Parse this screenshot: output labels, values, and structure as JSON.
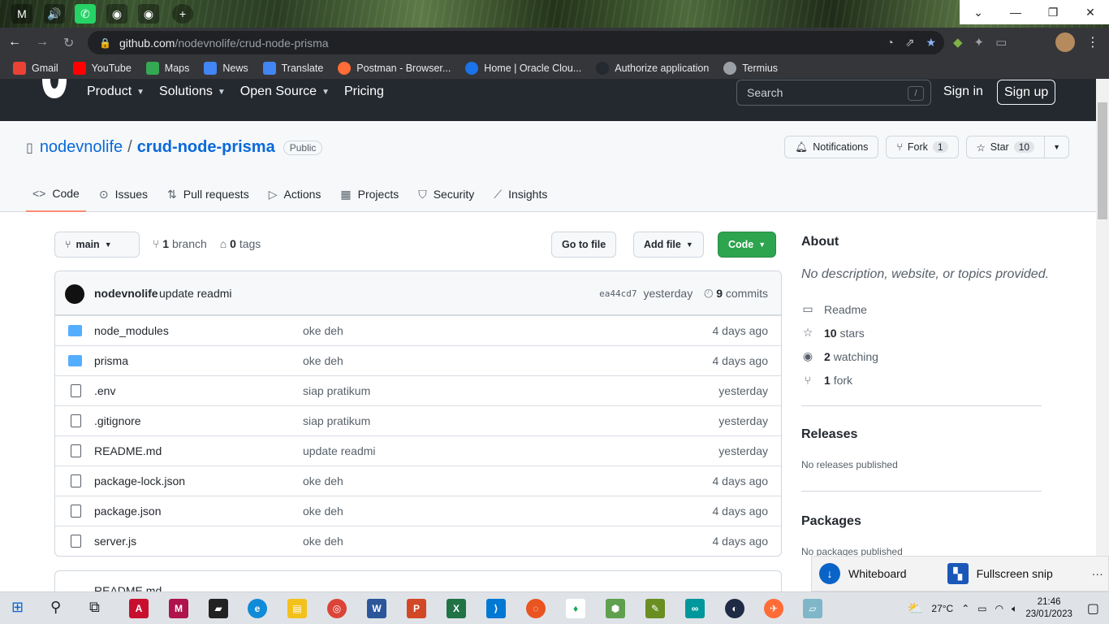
{
  "browser": {
    "address_host": "github.com",
    "address_path": "/nodevnolife/crud-node-prisma",
    "bookmarks": [
      {
        "label": "Gmail",
        "color": "#ea4335"
      },
      {
        "label": "YouTube",
        "color": "#ff0000"
      },
      {
        "label": "Maps",
        "color": "#34a853"
      },
      {
        "label": "News",
        "color": "#4285f4"
      },
      {
        "label": "Translate",
        "color": "#4285f4"
      },
      {
        "label": "Postman - Browser...",
        "color": "#ff6c37"
      },
      {
        "label": "Home | Oracle Clou...",
        "color": "#1a73e8"
      },
      {
        "label": "Authorize application",
        "color": "#24292f"
      },
      {
        "label": "Termius",
        "color": "#9aa0a6"
      }
    ]
  },
  "gh_header": {
    "nav": [
      "Product",
      "Solutions",
      "Open Source",
      "Pricing"
    ],
    "search_placeholder": "Search",
    "search_key": "/",
    "signin": "Sign in",
    "signup": "Sign up"
  },
  "repo": {
    "owner": "nodevnolife",
    "separator": "/",
    "name": "crud-node-prisma",
    "visibility": "Public",
    "notifications_label": "Notifications",
    "fork_label": "Fork",
    "fork_count": "1",
    "star_label": "Star",
    "star_count": "10",
    "tabs": [
      "Code",
      "Issues",
      "Pull requests",
      "Actions",
      "Projects",
      "Security",
      "Insights"
    ]
  },
  "main": {
    "branch": "main",
    "branch_count": "1",
    "branch_label": "branch",
    "tag_count": "0",
    "tag_label": "tags",
    "goto_file": "Go to file",
    "add_file": "Add file",
    "code": "Code",
    "commit": {
      "author": "nodevnolife",
      "message": "update readmi",
      "sha": "ea44cd7",
      "time": "yesterday",
      "count": "9",
      "count_label": "commits"
    },
    "files": [
      {
        "name": "node_modules",
        "type": "folder",
        "message": "oke deh",
        "age": "4 days ago"
      },
      {
        "name": "prisma",
        "type": "folder",
        "message": "oke deh",
        "age": "4 days ago"
      },
      {
        "name": ".env",
        "type": "file",
        "message": "siap pratikum",
        "age": "yesterday"
      },
      {
        "name": ".gitignore",
        "type": "file",
        "message": "siap pratikum",
        "age": "yesterday"
      },
      {
        "name": "README.md",
        "type": "file",
        "message": "update readmi",
        "age": "yesterday"
      },
      {
        "name": "package-lock.json",
        "type": "file",
        "message": "oke deh",
        "age": "4 days ago"
      },
      {
        "name": "package.json",
        "type": "file",
        "message": "oke deh",
        "age": "4 days ago"
      },
      {
        "name": "server.js",
        "type": "file",
        "message": "oke deh",
        "age": "4 days ago"
      }
    ],
    "readme_title": "README.md"
  },
  "sidebar": {
    "about_title": "About",
    "about_desc": "No description, website, or topics provided.",
    "readme": "Readme",
    "stars_count": "10",
    "stars_label": "stars",
    "watching_count": "2",
    "watching_label": "watching",
    "fork_count": "1",
    "fork_label": "fork",
    "releases_title": "Releases",
    "releases_text": "No releases published",
    "packages_title": "Packages",
    "packages_text": "No packages published"
  },
  "snip": {
    "whiteboard": "Whiteboard",
    "fullscreen": "Fullscreen snip",
    "more": "···"
  },
  "taskbar": {
    "temperature": "27°C",
    "time": "21:46",
    "date": "23/01/2023"
  }
}
